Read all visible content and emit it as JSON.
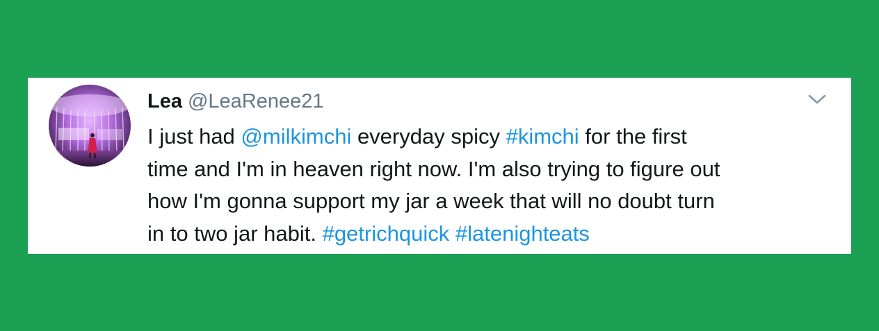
{
  "colors": {
    "background": "#1a9f53",
    "card": "#ffffff",
    "text": "#14171a",
    "muted": "#657786",
    "link": "#1b95e0"
  },
  "tweet": {
    "author_name": "Lea",
    "author_handle": "@LeaRenee21",
    "menu_icon": "chevron-down-icon",
    "avatar_icon": "profile-photo",
    "lines": [
      [
        {
          "text": "I just had ",
          "type": "text"
        },
        {
          "text": "@milkimchi",
          "type": "mention"
        },
        {
          "text": " everyday spicy ",
          "type": "text"
        },
        {
          "text": "#kimchi",
          "type": "hashtag"
        },
        {
          "text": " for the first",
          "type": "text"
        }
      ],
      [
        {
          "text": "time and I'm in heaven right now. I'm also trying to figure out",
          "type": "text"
        }
      ],
      [
        {
          "text": "how I'm gonna support my jar a week that will no doubt turn",
          "type": "text"
        }
      ],
      [
        {
          "text": "in to two jar habit. ",
          "type": "text"
        },
        {
          "text": "#getrichquick",
          "type": "hashtag"
        },
        {
          "text": " ",
          "type": "text"
        },
        {
          "text": "#latenighteats",
          "type": "hashtag"
        }
      ]
    ]
  }
}
